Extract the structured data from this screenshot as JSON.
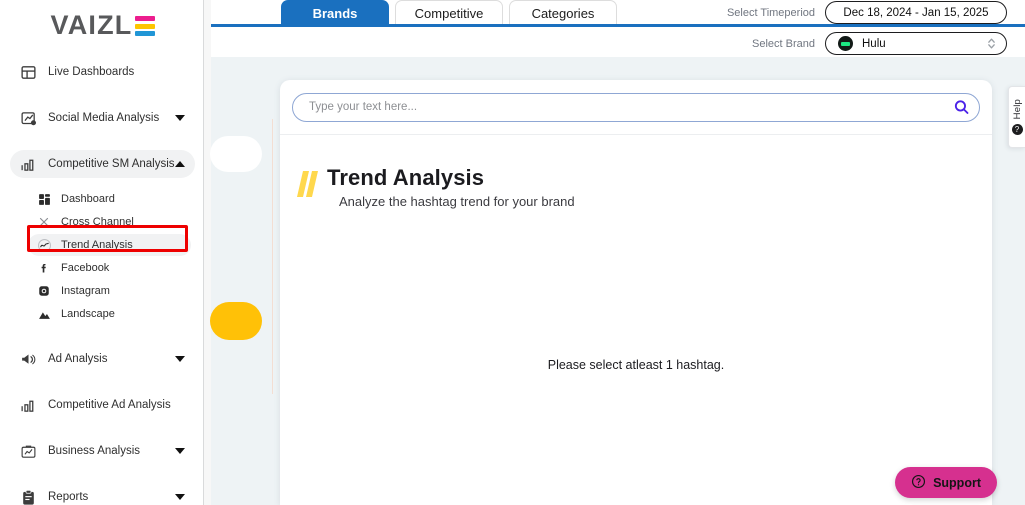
{
  "brand": {
    "name": "VAIZLE",
    "logo_colors": [
      "#ec1d8e",
      "#fdc500",
      "#2196d6"
    ]
  },
  "sidebar": {
    "items": [
      {
        "label": "Live Dashboards",
        "icon": "layout-dashboard-icon",
        "expandable": false
      },
      {
        "label": "Social Media Analysis",
        "icon": "chart-badge-icon",
        "expandable": true,
        "caret": "down"
      },
      {
        "label": "Competitive SM Analysis",
        "icon": "bar-chart-icon",
        "expandable": true,
        "caret": "up",
        "active": true
      },
      {
        "label": "Ad Analysis",
        "icon": "megaphone-icon",
        "expandable": true,
        "caret": "down"
      },
      {
        "label": "Competitive Ad Analysis",
        "icon": "bar-chart-icon",
        "expandable": false
      },
      {
        "label": "Business Analysis",
        "icon": "briefcase-chart-icon",
        "expandable": true,
        "caret": "down"
      },
      {
        "label": "Reports",
        "icon": "clipboard-icon",
        "expandable": true,
        "caret": "down"
      }
    ],
    "subitems": [
      {
        "label": "Dashboard",
        "icon": "grid-icon"
      },
      {
        "label": "Cross Channel",
        "icon": "cross-icon"
      },
      {
        "label": "Trend Analysis",
        "icon": "trend-line-icon",
        "selected": true,
        "highlighted": true
      },
      {
        "label": "Facebook",
        "icon": "facebook-icon"
      },
      {
        "label": "Instagram",
        "icon": "instagram-icon"
      },
      {
        "label": "Landscape",
        "icon": "landscape-icon"
      }
    ],
    "highlight_color": "#ee0000"
  },
  "topbar": {
    "tabs": [
      {
        "label": "Brands",
        "active": true
      },
      {
        "label": "Competitive",
        "active": false
      },
      {
        "label": "Categories",
        "active": false
      }
    ],
    "active_tab_color": "#1a70bf",
    "timeperiod": {
      "label": "Select Timeperiod",
      "value": "Dec 18, 2024 - Jan 15, 2025"
    },
    "brand_select": {
      "label": "Select Brand",
      "value": "Hulu",
      "avatar_icon": "hulu-avatar-icon"
    }
  },
  "search": {
    "placeholder": "Type your text here...",
    "value": "",
    "icon": "search-icon",
    "icon_color": "#4b22e8"
  },
  "page": {
    "title": "Trend Analysis",
    "subtitle": "Analyze the hashtag trend for your brand",
    "accent_color": "#ffd84d",
    "empty_message": "Please select atleast 1 hashtag."
  },
  "help_tab": {
    "label": "Help",
    "icon": "help-circle-icon"
  },
  "support": {
    "label": "Support",
    "icon": "question-circle-icon",
    "color": "#d6308f"
  }
}
